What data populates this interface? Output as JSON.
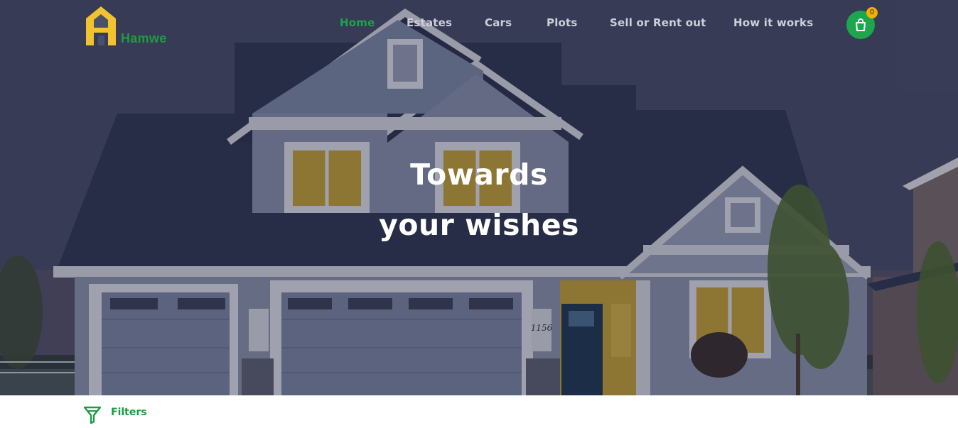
{
  "header": {
    "brand": "Hamwe",
    "nav": [
      {
        "label": "Home",
        "active": true
      },
      {
        "label": "Estates",
        "active": false
      },
      {
        "label": "Cars",
        "active": false
      },
      {
        "label": "Plots",
        "active": false
      },
      {
        "label": "Sell or Rent out",
        "active": false
      },
      {
        "label": "How it works",
        "active": false
      }
    ],
    "cart_count": "0"
  },
  "hero": {
    "line1": "Towards",
    "line2": "your wishes",
    "house_number": "1156"
  },
  "filters": {
    "label": "Filters"
  },
  "colors": {
    "accent": "#1fa04e",
    "logo_yellow": "#f2c230",
    "badge": "#f0b000"
  },
  "icons": {
    "logo": "house-logo-icon",
    "cart": "shopping-bag-icon",
    "filter": "funnel-icon"
  }
}
